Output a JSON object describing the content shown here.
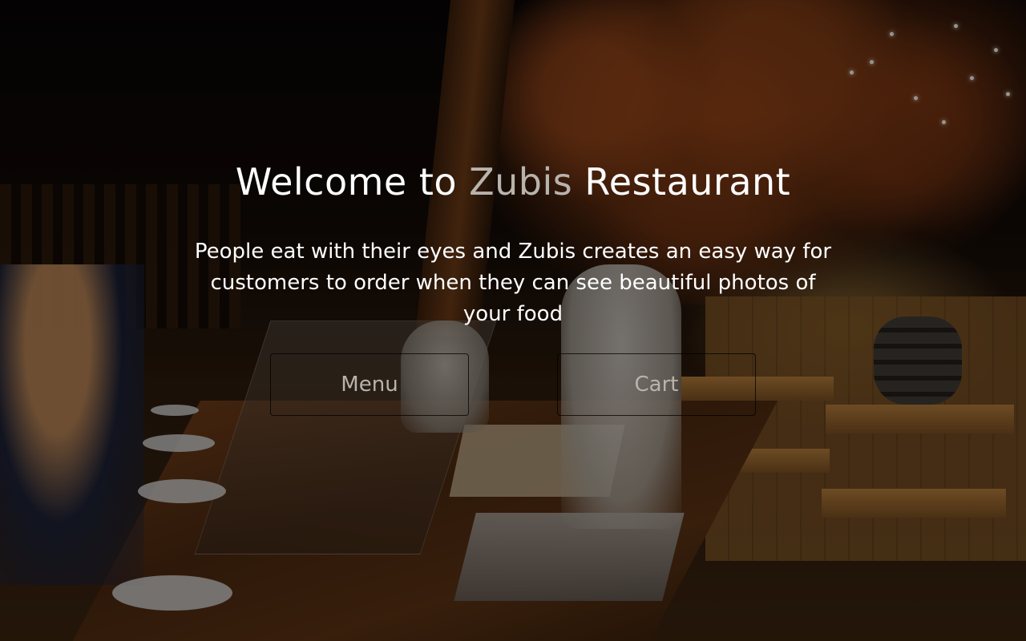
{
  "hero": {
    "title_prefix": "Welcome to ",
    "brand": "Zubis",
    "title_suffix": " Restaurant",
    "subtitle": "People eat with their eyes and Zubis creates an easy way for customers to order when they can see beautiful photos of your food"
  },
  "buttons": {
    "menu_label": "Menu",
    "cart_label": "Cart"
  },
  "colors": {
    "title": "#ffffff",
    "brand_accent": "#b9b3ae",
    "button_text": "#b9b3ae",
    "overlay": "rgba(0,0,0,0.38)"
  }
}
